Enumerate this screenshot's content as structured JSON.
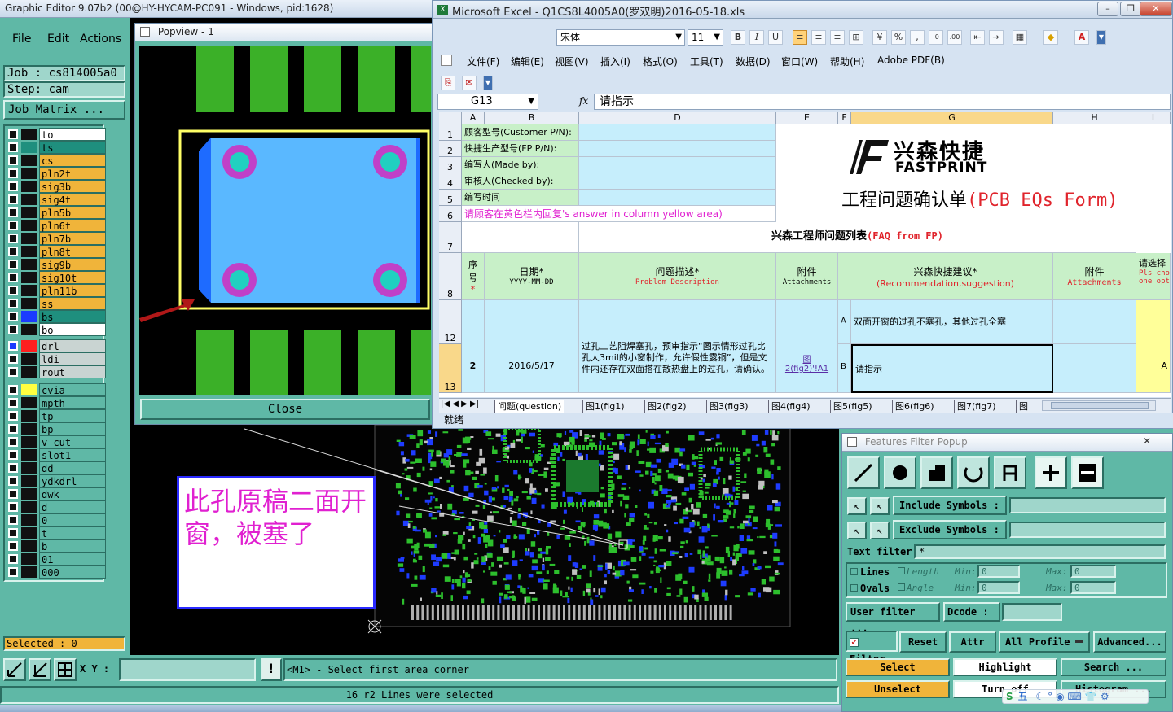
{
  "editor": {
    "title": "Graphic Editor 9.07b2 (00@HY-HYCAM-PC091 - Windows, pid:1628)",
    "menu": [
      "File",
      "Edit",
      "Actions"
    ],
    "job_label": "Job  : cs814005a0",
    "step_label": "Step: cam",
    "job_matrix": "Job Matrix ...",
    "layers": [
      {
        "name": "to",
        "color": "#ffffff",
        "sw": "#111111"
      },
      {
        "name": "ts",
        "color": "#1f8f7e",
        "sw": "#1f8f7e"
      },
      {
        "name": "cs",
        "color": "#f0b43a",
        "sw": "#111111"
      },
      {
        "name": "pln2t",
        "color": "#f0b43a",
        "sw": "#111111"
      },
      {
        "name": "sig3b",
        "color": "#f0b43a",
        "sw": "#111111"
      },
      {
        "name": "sig4t",
        "color": "#f0b43a",
        "sw": "#111111"
      },
      {
        "name": "pln5b",
        "color": "#f0b43a",
        "sw": "#111111"
      },
      {
        "name": "pln6t",
        "color": "#f0b43a",
        "sw": "#111111"
      },
      {
        "name": "pln7b",
        "color": "#f0b43a",
        "sw": "#111111"
      },
      {
        "name": "pln8t",
        "color": "#f0b43a",
        "sw": "#111111"
      },
      {
        "name": "sig9b",
        "color": "#f0b43a",
        "sw": "#111111"
      },
      {
        "name": "sig10t",
        "color": "#f0b43a",
        "sw": "#111111"
      },
      {
        "name": "pln11b",
        "color": "#f0b43a",
        "sw": "#111111"
      },
      {
        "name": "ss",
        "color": "#f0b43a",
        "sw": "#111111"
      },
      {
        "name": "bs",
        "color": "#1f8f7e",
        "sw": "#1b3bff"
      },
      {
        "name": "bo",
        "color": "#ffffff",
        "sw": "#111111"
      }
    ],
    "layers2": [
      {
        "name": "drl",
        "color": "#c9d4d2",
        "sw": "#ff1f1f"
      },
      {
        "name": "ldi",
        "color": "#c9d4d2",
        "sw": "#111111"
      },
      {
        "name": "rout",
        "color": "#c9d4d2",
        "sw": "#111111"
      }
    ],
    "layers3": [
      "cvia",
      "mpth",
      "tp",
      "bp",
      "v-cut",
      "slot1",
      "dd",
      "ydkdrl",
      "dwk",
      "d",
      "0",
      "t",
      "b",
      "01",
      "000"
    ],
    "selected": "Selected : 0",
    "xy_label": "X Y :",
    "prompt": "<M1> - Select first area corner",
    "status": "16 r2 Lines were selected",
    "annotation": "此孔原稿二面开窗，被塞了"
  },
  "popview": {
    "title": "Popview - 1",
    "close": "Close"
  },
  "excel": {
    "title": "Microsoft Excel - Q1CS8L4005A0(罗双明)2016-05-18.xls",
    "font": "宋体",
    "size": "11",
    "menu": [
      "文件(F)",
      "编辑(E)",
      "视图(V)",
      "插入(I)",
      "格式(O)",
      "工具(T)",
      "数据(D)",
      "窗口(W)",
      "帮助(H)",
      "Adobe PDF(B)"
    ],
    "namebox": "G13",
    "fx": "fx",
    "formula": "请指示",
    "columns": [
      "A",
      "B",
      "D",
      "E",
      "F",
      "G",
      "H",
      "I"
    ],
    "rows": [
      "1",
      "2",
      "3",
      "4",
      "5",
      "6",
      "7",
      "8",
      "12",
      "13"
    ],
    "labels": {
      "r1": "顾客型号(Customer P/N):",
      "r2": "快捷生产型号(FP P/N):",
      "r3": "编写人(Made by):",
      "r4": "审核人(Checked by):",
      "r5": "编写时间",
      "r6a": "请顾客在黄色栏内回复",
      "r6b": "'s answer in column yellow area)",
      "r7a": "兴森工程师问题列表",
      "r7b": "(FAQ from FP)"
    },
    "logo_cn": "兴森快捷",
    "logo_en": "FASTPRINT",
    "form_cn": "工程问题确认单",
    "form_en": "(PCB EQs Form)",
    "hdr": {
      "seq": "序号",
      "date": "日期*",
      "date_fmt": "YYYY-MM-DD",
      "desc": "问题描述*",
      "desc_en": "Problem Description",
      "att": "附件",
      "att_en": "Attachments",
      "sug": "兴森快捷建议*",
      "sug_en": "(Recommendation,suggestion)",
      "att2": "附件",
      "att2_en": "Attachments",
      "choose": "请选择",
      "choose_en": "Pls cho",
      "choose_en2": "one opt"
    },
    "row": {
      "num": "2",
      "date": "2016/5/17",
      "desc": "过孔工艺阻焊塞孔，预审指示“图示情形过孔比孔大3mil的小窗制作，允许假性露铜”，但是文件内还存在双面搭在散热盘上的过孔，请确认。",
      "link1": "图",
      "link2": "2(fig2)'!A1",
      "optA": "A",
      "optB": "B",
      "sugA": "双面开窗的过孔不塞孔，其他过孔全塞",
      "sugB": "请指示",
      "choice": "A"
    },
    "tabs": [
      "问题(question)",
      "图1(fig1)",
      "图2(fig2)",
      "图3(fig3)",
      "图4(fig4)",
      "图5(fig5)",
      "图6(fig6)",
      "图7(fig7)",
      "图"
    ],
    "status": "就绪"
  },
  "filter": {
    "title": "Features Filter Popup",
    "include": "Include Symbols :",
    "exclude": "Exclude Symbols :",
    "text_filter": "Text filter",
    "text_value": "*",
    "lines": "Lines",
    "ovals": "Ovals",
    "length": "Length",
    "angle": "Angle",
    "min": "Min:",
    "max": "Max:",
    "zero": "0",
    "user_filter": "User filter ...",
    "dcode": "Dcode :",
    "filter": "Filter",
    "reset": "Reset",
    "attr": "Attr ...",
    "all_profile": "All Profile",
    "advanced": "Advanced...",
    "select": "Select",
    "highlight": "Highlight",
    "search": "Search ...",
    "unselect": "Unselect",
    "turn_off": "Turn off",
    "histogram": "Histogram ..."
  },
  "ime": "五"
}
